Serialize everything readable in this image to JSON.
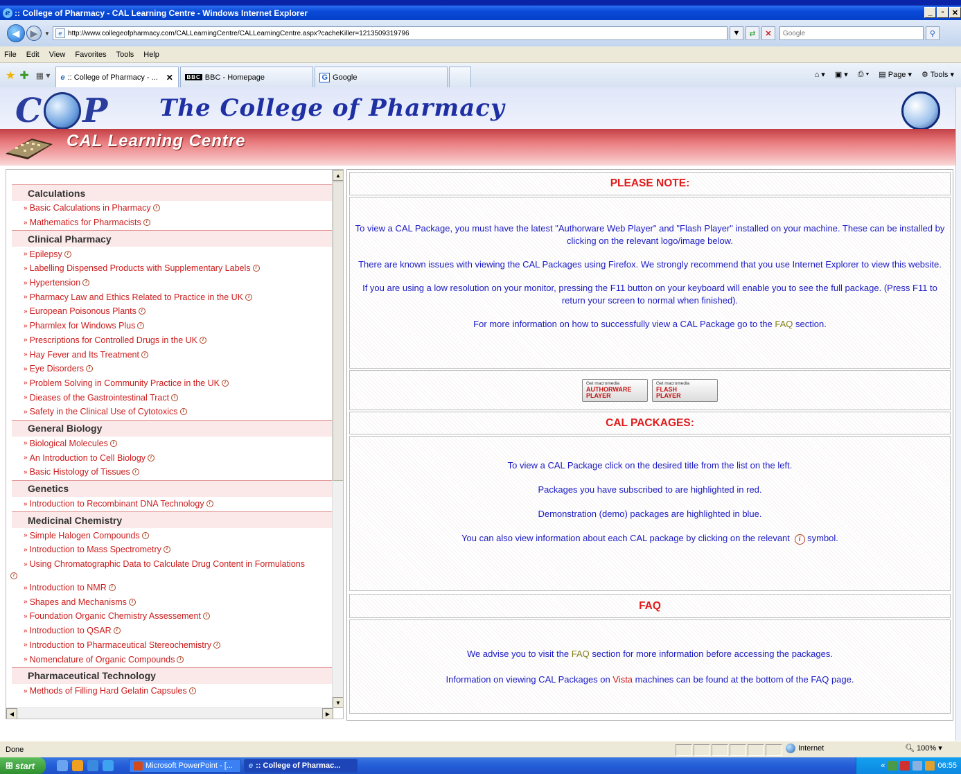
{
  "window": {
    "title": ":: College of Pharmacy - CAL Learning Centre - Windows Internet Explorer",
    "minimize": "_",
    "maximize": "1",
    "close": "x"
  },
  "addressbar": {
    "url": "http://www.collegeofpharmacy.com/CALLearningCentre/CALLearningCentre.aspx?cacheKiller=1213509319796",
    "search_placeholder": "Google"
  },
  "menu": [
    "File",
    "Edit",
    "View",
    "Favorites",
    "Tools",
    "Help"
  ],
  "tabs": [
    {
      "label": ":: College of Pharmacy - ...",
      "close": "✕"
    },
    {
      "label": "BBC - Homepage",
      "logo": "BBC"
    },
    {
      "label": "Google",
      "logo": "G"
    }
  ],
  "command_bar": {
    "page_label": "Page",
    "tools_label": "Tools"
  },
  "header": {
    "logo_left": "C",
    "logo_right": "P",
    "title": "The College of Pharmacy",
    "subtitle": "CAL Learning Centre"
  },
  "nav": {
    "categories": [
      {
        "name": "Calculations",
        "items": [
          {
            "label": "Basic Calculations in Pharmacy"
          },
          {
            "label": "Mathematics for Pharmacists"
          }
        ]
      },
      {
        "name": "Clinical Pharmacy",
        "items": [
          {
            "label": "Epilepsy"
          },
          {
            "label": "Labelling Dispensed Products with Supplementary Labels"
          },
          {
            "label": "Hypertension"
          },
          {
            "label": "Pharmacy Law and Ethics Related to Practice in the UK"
          },
          {
            "label": "European Poisonous Plants"
          },
          {
            "label": "Pharmlex for Windows Plus"
          },
          {
            "label": "Prescriptions for Controlled Drugs in the UK"
          },
          {
            "label": "Hay Fever and Its Treatment"
          },
          {
            "label": "Eye Disorders"
          },
          {
            "label": "Problem Solving in Community Practice in the UK"
          },
          {
            "label": "Dieases of the Gastrointestinal Tract"
          },
          {
            "label": "Safety in the Clinical Use of Cytotoxics"
          }
        ]
      },
      {
        "name": "General Biology",
        "items": [
          {
            "label": "Biological Molecules"
          },
          {
            "label": "An Introduction to Cell Biology"
          },
          {
            "label": "Basic Histology of Tissues"
          }
        ]
      },
      {
        "name": "Genetics",
        "items": [
          {
            "label": "Introduction to Recombinant DNA Technology"
          }
        ]
      },
      {
        "name": "Medicinal Chemistry",
        "items": [
          {
            "label": "Simple Halogen Compounds"
          },
          {
            "label": "Introduction to Mass Spectrometry"
          },
          {
            "label": "Using Chromatographic Data to Calculate Drug Content in Formulations",
            "wrap": true
          },
          {
            "label": "Introduction to NMR"
          },
          {
            "label": "Shapes and Mechanisms"
          },
          {
            "label": "Foundation Organic Chemistry Assessement"
          },
          {
            "label": "Introduction to QSAR"
          },
          {
            "label": "Introduction to Pharmaceutical Stereochemistry"
          },
          {
            "label": "Nomenclature of Organic Compounds"
          }
        ]
      },
      {
        "name": "Pharmaceutical Technology",
        "items": [
          {
            "label": "Methods of Filling Hard Gelatin Capsules"
          }
        ]
      }
    ]
  },
  "content": {
    "note_header": "PLEASE NOTE:",
    "note_p1": "To view a CAL Package, you must have the latest \"Authorware Web Player\" and \"Flash Player\" installed on your machine. These can be installed by clicking on the relevant logo/image below.",
    "note_p2": "There are known issues with viewing the CAL Packages using Firefox. We strongly recommend that you use Internet Explorer to view this website.",
    "note_p3": "If you are using a low resolution on your monitor, pressing the F11 button on your keyboard will enable you to see the full package. (Press F11 to return your screen to normal when finished).",
    "note_p4_a": "For more information on how to successfully view a CAL Package go to the ",
    "note_p4_link": "FAQ",
    "note_p4_b": "  section.",
    "badge_aw_top": "Get macromedia",
    "badge_aw_l1": "AUTHORWARE",
    "badge_aw_l2": "PLAYER",
    "badge_fl_top": "Get macromedia",
    "badge_fl_l1": "FLASH",
    "badge_fl_l2": "PLAYER",
    "packages_header": "CAL PACKAGES:",
    "pkg_p1": "To view a CAL Package click on the desired title from the list on the left.",
    "pkg_p2": "Packages you have subscribed to are highlighted in red.",
    "pkg_p3": "Demonstration (demo) packages are highlighted in blue.",
    "pkg_p4_a": "You can also view information about each CAL package by clicking on the relevant ",
    "pkg_p4_b": " symbol.",
    "faq_header": "FAQ",
    "faq_p1_a": "We advise you to visit the ",
    "faq_p1_link": "FAQ",
    "faq_p1_b": " section for more information before accessing the packages.",
    "faq_p2_a": "Information on viewing CAL Packages on ",
    "faq_p2_vista": "Vista",
    "faq_p2_b": " machines can be found at the bottom of the FAQ page."
  },
  "status": {
    "text": "Done",
    "zone": "Internet",
    "zoom": "100%"
  },
  "taskbar": {
    "start": "start",
    "buttons": [
      {
        "label": "Microsoft PowerPoint - [..."
      },
      {
        "label": ":: College of Pharmac..."
      }
    ],
    "clock": "06:55"
  }
}
